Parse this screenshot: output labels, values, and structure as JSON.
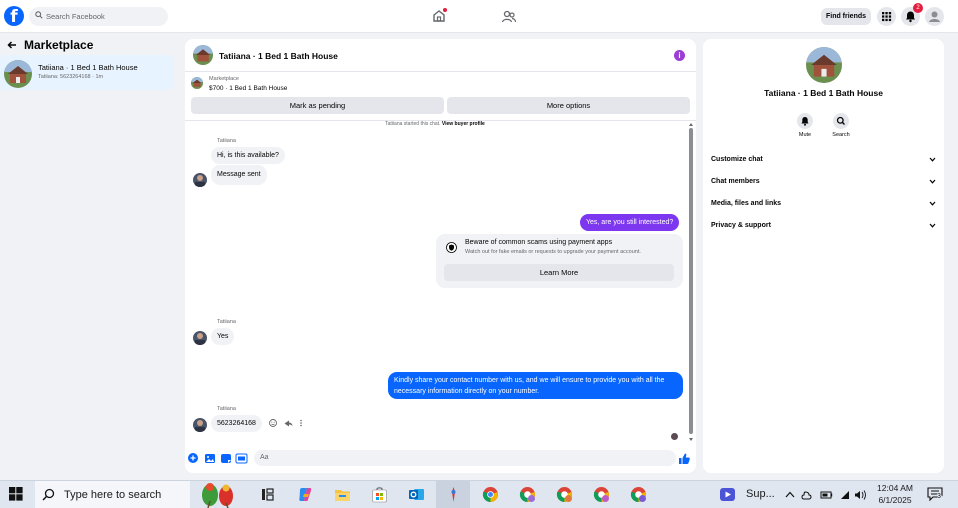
{
  "topbar": {
    "logo": "f",
    "search_placeholder": "Search Facebook",
    "find_friends": "Find friends",
    "notification_count": "2"
  },
  "left": {
    "title": "Marketplace",
    "conversation": {
      "title": "Tatiiana · 1 Bed 1 Bath House",
      "subtitle": "Tatiiana: 5623264168 · 1m"
    }
  },
  "chat": {
    "title": "Tatiiana · 1 Bed 1 Bath House",
    "info_icon": "i",
    "marketplace_label": "Marketplace",
    "listing": "$700 · 1 Bed 1 Bath House",
    "mark_pending": "Mark as pending",
    "more_options": "More options",
    "started_text": "Tatiiana started this chat.",
    "view_buyer": "View buyer profile",
    "messages": {
      "m1_sender": "Tatiiana",
      "m1": "Hi, is this available?",
      "m2": "Message sent",
      "m3": "Yes, are you still interested?",
      "scam_title": "Beware of common scams using payment apps",
      "scam_desc": "Watch out for fake emails or requests to upgrade your payment account.",
      "learn_more": "Learn More",
      "m4_sender": "Tatiiana",
      "m4": "Yes",
      "m5": "Kindly share your contact number with us, and we will ensure to provide you with all the necessary information directly on your number.",
      "m6_sender": "Tatiiana",
      "m6": "5623264168"
    },
    "composer_placeholder": "Aa"
  },
  "info": {
    "title": "Tatiiana · 1 Bed 1 Bath House",
    "mute": "Mute",
    "search": "Search",
    "sections": [
      "Customize chat",
      "Chat members",
      "Media, files and links",
      "Privacy & support"
    ]
  },
  "taskbar": {
    "search_placeholder": "Type here to search",
    "app_label": "Sup...",
    "time": "12:04 AM",
    "date": "6/1/2025",
    "notif_count": "3"
  },
  "colors": {
    "brand_blue": "#0866ff",
    "purple": "#7e37f0",
    "badge_red": "#e41e3f"
  }
}
